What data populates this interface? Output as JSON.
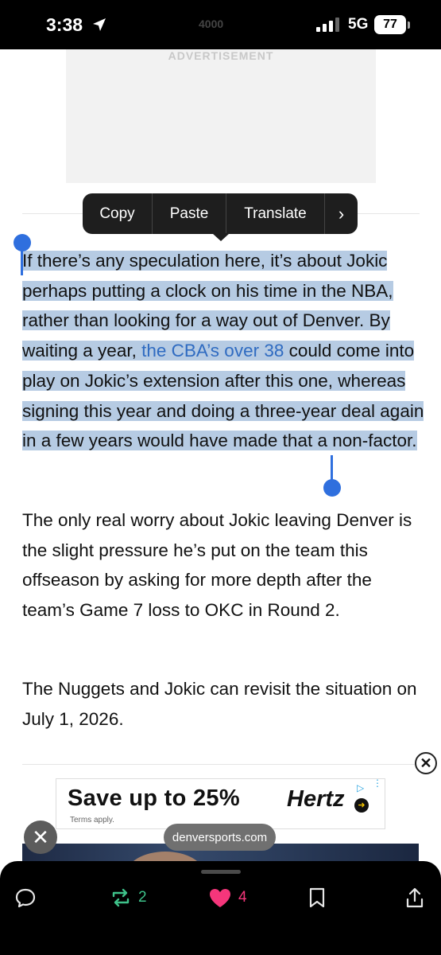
{
  "status_bar": {
    "time": "3:38",
    "network": "5G",
    "battery": "77",
    "center_text": "4000"
  },
  "ad_top": {
    "label": "ADVERTISEMENT"
  },
  "context_menu": {
    "items": [
      "Copy",
      "Paste",
      "Translate"
    ],
    "more": "›"
  },
  "article": {
    "p1": {
      "before": "If there’s any speculation here, it’s about Jokic perhaps putting a clock on his time in the NBA, rather than looking for a way out of Denver. By waiting a year, ",
      "link": "the CBA’s over 38",
      "after": " could come into play on Jokic’s extension after this one, whereas signing this year and doing a three-year deal again in a few years would have made that a non-factor."
    },
    "p2": "The only real worry about Jokic leaving Denver is the slight pressure he’s put on the team this offseason by asking for more depth after the team’s Game 7 loss to OKC in Round 2.",
    "p3": "The Nuggets and Jokic can revisit the situation on July 1, 2026."
  },
  "ad_bottom": {
    "headline": "Save up to 25%",
    "terms": "Terms apply.",
    "brand": "Hertz",
    "close": "✕"
  },
  "url_pill": "denversports.com",
  "toolbar": {
    "repost_count": "2",
    "like_count": "4"
  },
  "colors": {
    "selection": "#b6cbe3",
    "link": "#2f6bc1",
    "repost": "#3ec28a",
    "like": "#f5367b"
  }
}
